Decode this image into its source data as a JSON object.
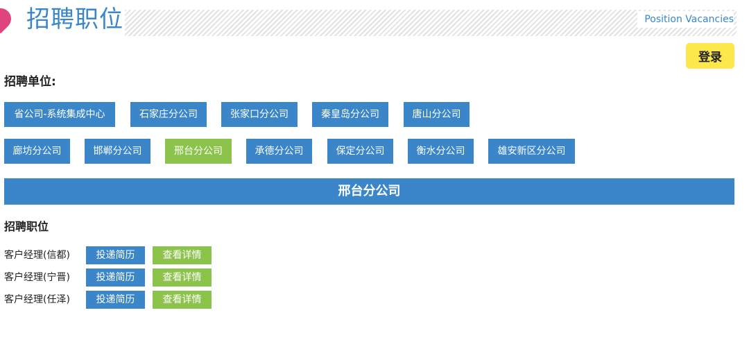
{
  "header": {
    "title": "招聘职位",
    "subtitle_en": "Position Vacancies"
  },
  "login_label": "登录",
  "units_label": "招聘单位:",
  "units": [
    {
      "label": "省公司-系统集成中心"
    },
    {
      "label": "石家庄分公司"
    },
    {
      "label": "张家口分公司"
    },
    {
      "label": "秦皇岛分公司"
    },
    {
      "label": "唐山分公司"
    },
    {
      "label": "廊坊分公司"
    },
    {
      "label": "邯郸分公司"
    },
    {
      "label": "邢台分公司"
    },
    {
      "label": "承德分公司"
    },
    {
      "label": "保定分公司"
    },
    {
      "label": "衡水分公司"
    },
    {
      "label": "雄安新区分公司"
    }
  ],
  "selected_unit": "邢台分公司",
  "positions_label": "招聘职位",
  "positions": [
    {
      "name": "客户经理(信都)",
      "apply_label": "投递简历",
      "detail_label": "查看详情"
    },
    {
      "name": "客户经理(宁晋)",
      "apply_label": "投递简历",
      "detail_label": "查看详情"
    },
    {
      "name": "客户经理(任泽)",
      "apply_label": "投递简历",
      "detail_label": "查看详情"
    }
  ],
  "colors": {
    "primary": "#3a86c8",
    "active": "#8cc34a",
    "login": "#fbe84b",
    "pin": "#e0447e"
  }
}
